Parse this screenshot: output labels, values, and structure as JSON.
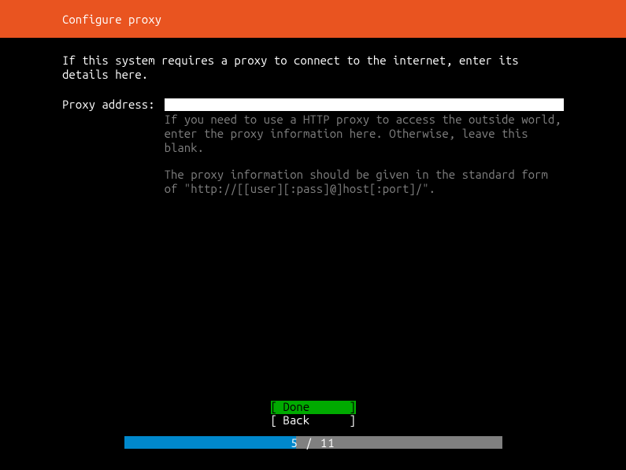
{
  "header": {
    "title": "Configure proxy"
  },
  "intro": {
    "text": "If this system requires a proxy to connect to the internet, enter its details here."
  },
  "form": {
    "proxy_label": "Proxy address:",
    "proxy_value": "",
    "help1": "If you need to use a HTTP proxy to access the outside world, enter the proxy information here. Otherwise, leave this blank.",
    "help2": "The proxy information should be given in the standard form of \"http://[[user][:pass]@]host[:port]/\"."
  },
  "buttons": {
    "done_left": "[ ",
    "done_label": "Done",
    "done_right": "]",
    "back_left": "[ ",
    "back_label": "Back",
    "back_right": "]"
  },
  "progress": {
    "text": "5 / 11",
    "percent": 45.5
  }
}
